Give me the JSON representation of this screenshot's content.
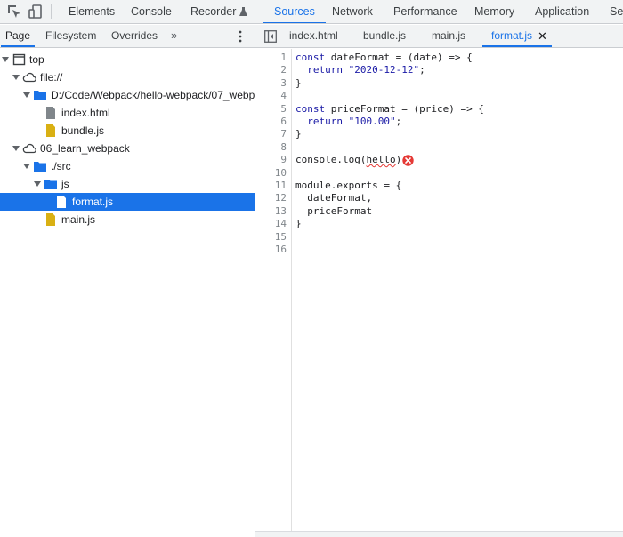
{
  "topbar": {
    "tabs": [
      {
        "label": "Elements"
      },
      {
        "label": "Console"
      },
      {
        "label": "Recorder"
      },
      {
        "label": "Sources",
        "active": true
      },
      {
        "label": "Network"
      },
      {
        "label": "Performance"
      },
      {
        "label": "Memory"
      },
      {
        "label": "Application"
      },
      {
        "label": "Se"
      }
    ],
    "icons": [
      "inspect-element-icon",
      "device-toolbar-icon",
      "flask-icon"
    ]
  },
  "navigator": {
    "tabs": [
      {
        "label": "Page",
        "active": true
      },
      {
        "label": "Filesystem"
      },
      {
        "label": "Overrides"
      }
    ],
    "more_label": "»",
    "tree": [
      {
        "label": "top",
        "icon": "frame-icon"
      },
      {
        "label": "file://",
        "icon": "cloud-icon"
      },
      {
        "label": "D:/Code/Webpack/hello-webpack/07_webp",
        "icon": "folder-icon"
      },
      {
        "label": "index.html",
        "icon": "file-icon"
      },
      {
        "label": "bundle.js",
        "icon": "js-file-icon"
      },
      {
        "label": "06_learn_webpack",
        "icon": "cloud-icon"
      },
      {
        "label": "./src",
        "icon": "folder-icon"
      },
      {
        "label": "js",
        "icon": "folder-icon"
      },
      {
        "label": "format.js",
        "icon": "file-icon",
        "selected": true
      },
      {
        "label": "main.js",
        "icon": "js-file-icon"
      }
    ]
  },
  "editor": {
    "tabs": [
      {
        "label": "index.html"
      },
      {
        "label": "bundle.js"
      },
      {
        "label": "main.js"
      },
      {
        "label": "format.js",
        "active": true
      }
    ],
    "close_label": "✕",
    "line_numbers": [
      "1",
      "2",
      "3",
      "4",
      "5",
      "6",
      "7",
      "8",
      "9",
      "10",
      "11",
      "12",
      "13",
      "14",
      "15",
      "16"
    ],
    "lines": [
      {
        "kw": "const",
        "rest": " dateFormat = (date) => {"
      },
      {
        "indent": "  ",
        "kw": "return",
        "str": " \"2020-12-12\"",
        "rest": ";"
      },
      {
        "rest": "}"
      },
      {
        "rest": ""
      },
      {
        "kw": "const",
        "rest": " priceFormat = (price) => {"
      },
      {
        "indent": "  ",
        "kw": "return",
        "str": " \"100.00\"",
        "rest": ";"
      },
      {
        "rest": "}"
      },
      {
        "rest": ""
      },
      {
        "pre": "console.log(",
        "err": "hello",
        "post": ")"
      },
      {
        "rest": ""
      },
      {
        "rest": "module.exports = {"
      },
      {
        "rest": "  dateFormat,"
      },
      {
        "rest": "  priceFormat"
      },
      {
        "rest": "}"
      },
      {
        "rest": ""
      },
      {
        "rest": ""
      }
    ],
    "error_icon": "error-icon"
  },
  "colors": {
    "accent": "#1a73e8",
    "error": "#e53935",
    "folder": "#1a73e8",
    "js_file": "#d9b013"
  }
}
